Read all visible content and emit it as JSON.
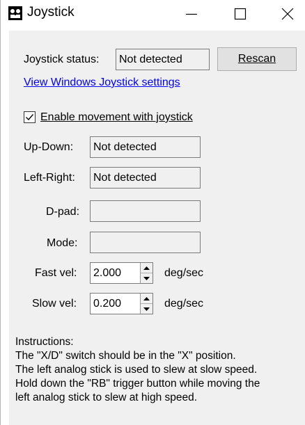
{
  "window": {
    "title": "Joystick"
  },
  "status": {
    "label": "Joystick status:",
    "value": "Not detected",
    "rescan_label": "Rescan",
    "settings_link": "View Windows Joystick settings"
  },
  "enable": {
    "label": "Enable movement with joystick",
    "checked": true
  },
  "axes": {
    "updown_label": "Up-Down:",
    "updown_value": "Not detected",
    "leftright_label": "Left-Right:",
    "leftright_value": "Not detected",
    "dpad_label": "D-pad:",
    "dpad_value": "",
    "mode_label": "Mode:",
    "mode_value": ""
  },
  "velocity": {
    "fast_label": "Fast vel:",
    "fast_value": "2.000",
    "fast_unit": "deg/sec",
    "slow_label": "Slow vel:",
    "slow_value": "0.200",
    "slow_unit": "deg/sec"
  },
  "instructions": {
    "lines": [
      "Instructions:",
      "The \"X/D\" switch should be in the \"X\" position.",
      "The left analog stick is used to slew at slow speed.",
      "Hold down the \"RB\" trigger button while moving the",
      "left analog stick to slew at high speed."
    ]
  }
}
